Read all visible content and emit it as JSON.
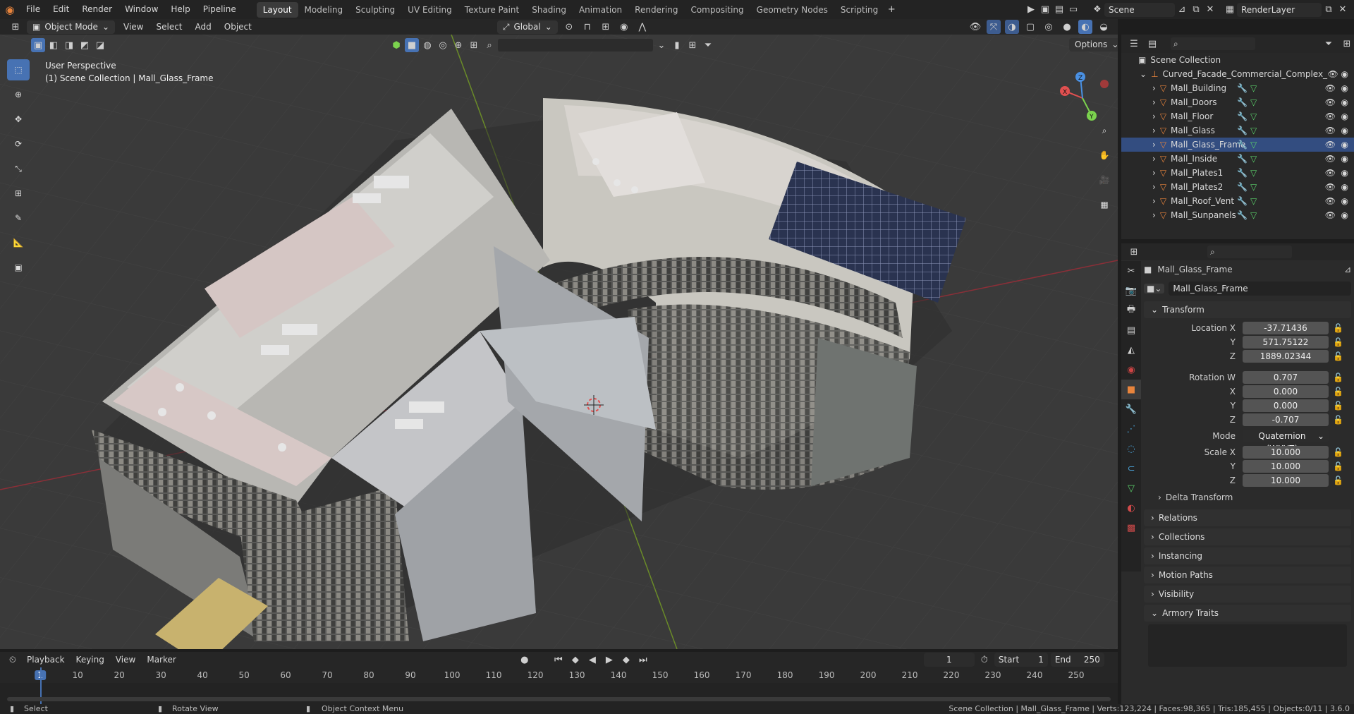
{
  "topbar": {
    "menus": [
      "File",
      "Edit",
      "Render",
      "Window",
      "Help",
      "Pipeline"
    ],
    "workspaces": [
      "Layout",
      "Modeling",
      "Sculpting",
      "UV Editing",
      "Texture Paint",
      "Shading",
      "Animation",
      "Rendering",
      "Compositing",
      "Geometry Nodes",
      "Scripting"
    ],
    "active_workspace": "Layout",
    "scene": "Scene",
    "view_layer": "RenderLayer"
  },
  "viewport_header": {
    "mode": "Object Mode",
    "menus": [
      "View",
      "Select",
      "Add",
      "Object"
    ],
    "orientation": "Global",
    "options_label": "Options"
  },
  "viewport": {
    "perspective_label": "User Perspective",
    "context_label": "(1) Scene Collection | Mall_Glass_Frame",
    "gizmo_axes": [
      "X",
      "Y",
      "Z"
    ]
  },
  "outliner": {
    "root": "Scene Collection",
    "collection": "Curved_Facade_Commercial_Complex_",
    "objects": [
      "Mall_Building",
      "Mall_Doors",
      "Mall_Floor",
      "Mall_Glass",
      "Mall_Glass_Frame",
      "Mall_Inside",
      "Mall_Plates1",
      "Mall_Plates2",
      "Mall_Roof_Vent",
      "Mall_Sunpanels"
    ],
    "selected": "Mall_Glass_Frame"
  },
  "properties": {
    "object_name": "Mall_Glass_Frame",
    "datablock": "Mall_Glass_Frame",
    "transform_label": "Transform",
    "location": {
      "label": "Location X",
      "x": "-37.71436",
      "y": "571.75122",
      "z": "1889.02344"
    },
    "rotation": {
      "label": "Rotation W",
      "w": "0.707",
      "x": "0.000",
      "y": "0.000",
      "z": "-0.707"
    },
    "mode_label": "Mode",
    "mode_value": "Quaternion (WXYZ)",
    "scale": {
      "label": "Scale X",
      "x": "10.000",
      "y": "10.000",
      "z": "10.000"
    },
    "axis_labels": {
      "x": "X",
      "y": "Y",
      "z": "Z"
    },
    "delta_transform": "Delta Transform",
    "panels": [
      "Relations",
      "Collections",
      "Instancing",
      "Motion Paths",
      "Visibility",
      "Armory Traits"
    ]
  },
  "timeline": {
    "menus": [
      "Playback",
      "Keying",
      "View",
      "Marker"
    ],
    "current_frame": "1",
    "start_label": "Start",
    "start": "1",
    "end_label": "End",
    "end": "250",
    "ticks": [
      "1",
      "10",
      "20",
      "30",
      "40",
      "50",
      "60",
      "70",
      "80",
      "90",
      "100",
      "110",
      "120",
      "130",
      "140",
      "150",
      "160",
      "170",
      "180",
      "190",
      "200",
      "210",
      "220",
      "230",
      "240",
      "250"
    ]
  },
  "statusbar": {
    "select": "Select",
    "rotate": "Rotate View",
    "context_menu": "Object Context Menu",
    "stats": "Scene Collection | Mall_Glass_Frame | Verts:123,224 | Faces:98,365 | Tris:185,455 | Objects:0/11 | 3.6.0"
  },
  "colors": {
    "accent": "#4772b3",
    "mesh_icon": "#e8843c",
    "modifier_icon": "#4aa3d8",
    "object_data_icon": "#5ad06a"
  }
}
